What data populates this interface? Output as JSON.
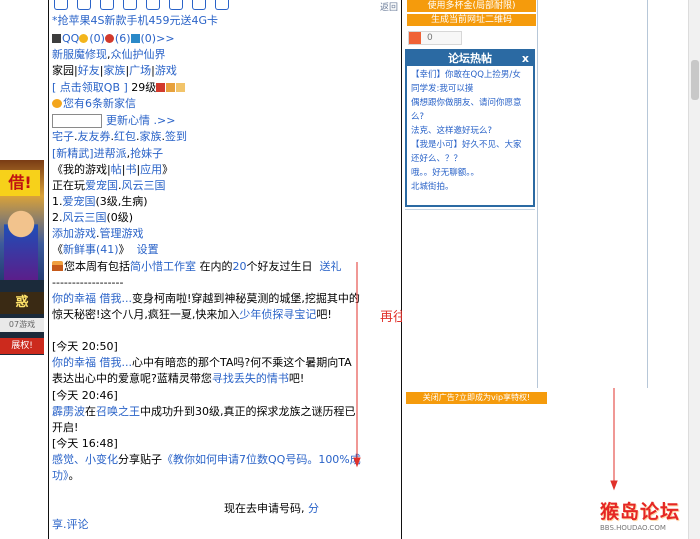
{
  "main": {
    "promo_link": "*抢苹果4S新款手机459元送4G卡",
    "qq_line": {
      "qq": "QQ",
      "c1": "(0)",
      "c2": "(6)",
      "c3": "(0)>>"
    },
    "news_links": [
      "新服魔修现",
      "众仙护仙界"
    ],
    "home_line": {
      "home": "家园",
      "friends": "好友",
      "family": "家族",
      "square": "广场",
      "game": "游戏"
    },
    "qb_line": {
      "qb": "[ 点击领取QB ]",
      "level": "29级"
    },
    "new_letters": "您有6条新家信",
    "update_mood": "更新心情 .>>",
    "links_line": [
      "宅子",
      "友友券",
      "红包",
      "家族",
      "签到"
    ],
    "new_play": [
      "[新精武]",
      "进帮派",
      "抢妹子"
    ],
    "my_games": {
      "prefix": "《我的游戏|",
      "posts": "帖",
      "book": "书",
      "apps": "应用",
      "suffix": "》"
    },
    "playing": {
      "prefix": "正在玩",
      "game1": "爱宠国",
      "game2": "风云三国"
    },
    "game_list": [
      {
        "num": "1.",
        "name": "爱宠国",
        "detail": "(3级,生病)"
      },
      {
        "num": "2.",
        "name": "风云三国",
        "detail": "(0级)"
      }
    ],
    "add_game": "添加游戏",
    "manage_game": "管理游戏",
    "fresh": {
      "prefix": "《",
      "label": "新鲜事(41)",
      "suffix": "》",
      "settings": "设置"
    },
    "birthday": {
      "pre": "您本周有包括",
      "name": "简小惜工作室",
      "mid": "在内的",
      "num": "20",
      "post": "个好友过生日",
      "send": "送礼"
    },
    "divider": "------------------",
    "feed": [
      {
        "author": "你的幸福 借我...",
        "text": "变身柯南啦!穿越到神秘莫测的城堡,挖掘其中的惊天秘密!这个八月,疯狂一夏,快来加入",
        "link": "少年侦探寻宝记",
        "tail": "吧!"
      },
      {
        "time": "[今天 20:50]"
      },
      {
        "author": "你的幸福 借我...",
        "text": "心中有暗恋的那个TA吗?何不乘这个暑期向TA表达出心中的爱意呢?蓝精灵带您",
        "link": "寻找丢失的情书",
        "tail": "吧!"
      },
      {
        "time": "[今天 20:46]"
      },
      {
        "author": "霹雳波",
        "text1": "在",
        "link": "召唤之王",
        "text2": "中成功升到30级,真正的探求龙族之谜历程已开启!"
      },
      {
        "time": "[今天 16:48]"
      },
      {
        "author": "感觉、小变化",
        "text1": "分享贴子",
        "link": "《教你如何申请7位数QQ号码。100%成功》",
        "tail": "。"
      }
    ],
    "apply_line": "现在去申请号码,",
    "share": "分",
    "share2": "享.评论"
  },
  "right": {
    "btn1": "使用多杯金(局部耐限)",
    "btn2": "生成当前网址二维码",
    "like_count": "0",
    "forum_title": "论坛热帖",
    "forum_close": "x",
    "forum_posts": [
      "【幸们】你敢在QQ上捡男/女",
      "同学发:我可以摸",
      "偶想跟你做朋友、请问你愿意么?",
      "法克、这样邀好玩么?",
      "【我是小可】好久不见、大家还好么、？？",
      "哦。。好无聊额。。",
      "北城街拍。"
    ],
    "close_ad": "关闭广告?立即成为vip享特权!"
  },
  "corner": "返回",
  "annotation": "再往下拉",
  "watermark": {
    "big": "猴岛论坛",
    "small": "BBS.HOUDAO.COM"
  },
  "left_ad": {
    "badge": "借!",
    "bar1": "惑",
    "bar2": "07游戏",
    "bar3": "展权!"
  },
  "colors": {
    "link": "#2a63c8",
    "orange": "#f59b0c",
    "forum_blue": "#2b6aa3",
    "annotation_red": "#e0312b"
  }
}
